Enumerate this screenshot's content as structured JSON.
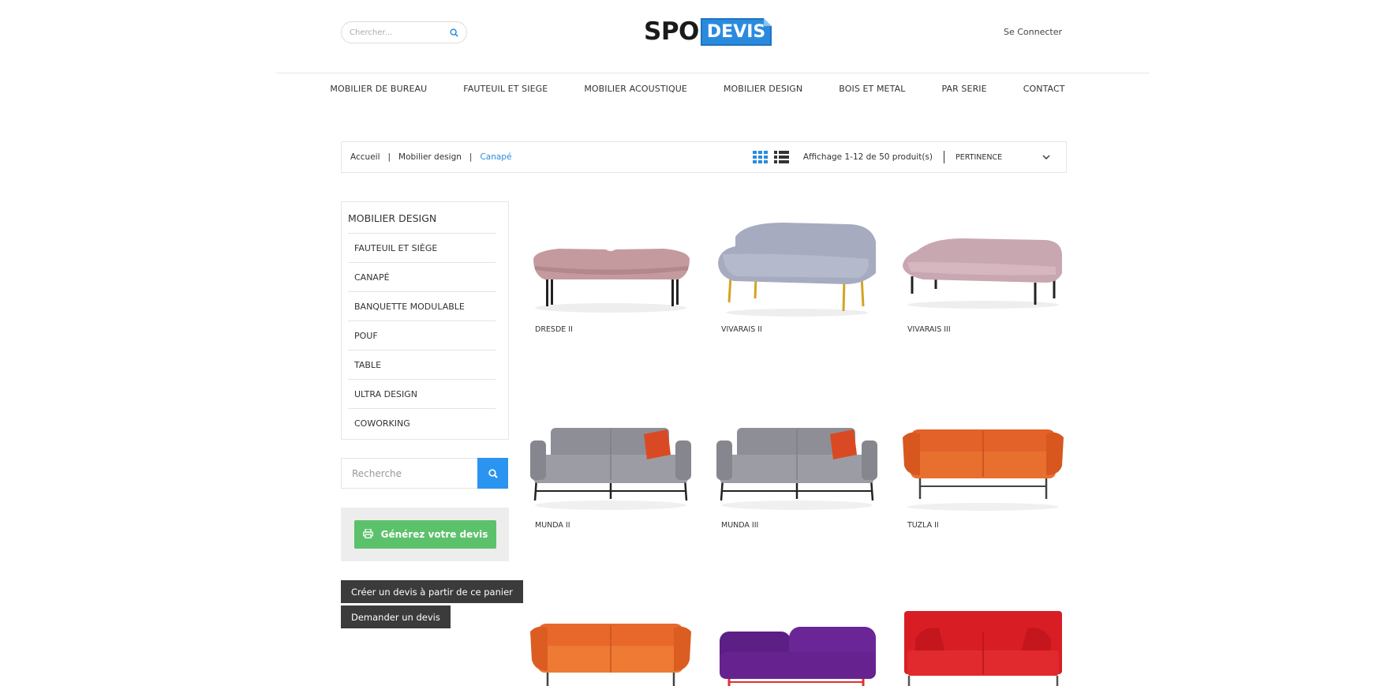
{
  "header": {
    "search_placeholder": "Chercher...",
    "logo_left": "SPO",
    "logo_right": "DEVIS",
    "login": "Se Connecter"
  },
  "nav": [
    "MOBILIER DE BUREAU",
    "FAUTEUIL ET SIEGE",
    "MOBILIER ACOUSTIQUE",
    "MOBILIER DESIGN",
    "BOIS ET METAL",
    "PAR SERIE",
    "CONTACT"
  ],
  "breadcrumb": [
    "Accueil",
    "Mobilier design",
    "Canapé"
  ],
  "toolbar": {
    "count": "Affichage 1-12 de 50 produit(s)",
    "sort": "PERTINENCE"
  },
  "sidebar": {
    "title": "MOBILIER DESIGN",
    "items": [
      "FAUTEUIL ET SIÈGE",
      "CANAPÉ",
      "BANQUETTE MODULABLE",
      "POUF",
      "TABLE",
      "ULTRA DESIGN",
      "COWORKING"
    ],
    "search_placeholder": "Recherche",
    "devis_button": "Générez votre devis",
    "create_quote": "Créer un devis à partir de ce panier",
    "request_quote": "Demander un devis"
  },
  "products": [
    {
      "name": "DRESDE II",
      "color": "#c59a9f"
    },
    {
      "name": "VIVARAIS II",
      "color": "#a7abc0"
    },
    {
      "name": "VIVARAIS III",
      "color": "#c8a7b1"
    },
    {
      "name": "MUNDA II",
      "color": "#8e8f96"
    },
    {
      "name": "MUNDA III",
      "color": "#8e8f96"
    },
    {
      "name": "TUZLA II",
      "color": "#e2622a"
    },
    {
      "name": "",
      "color": "#e8682b"
    },
    {
      "name": "",
      "color": "#5b1f86"
    },
    {
      "name": "",
      "color": "#d81e24"
    }
  ],
  "colors": {
    "accent": "#2a8bde",
    "green": "#5cc16b",
    "dark_button": "#3b3b3b"
  }
}
